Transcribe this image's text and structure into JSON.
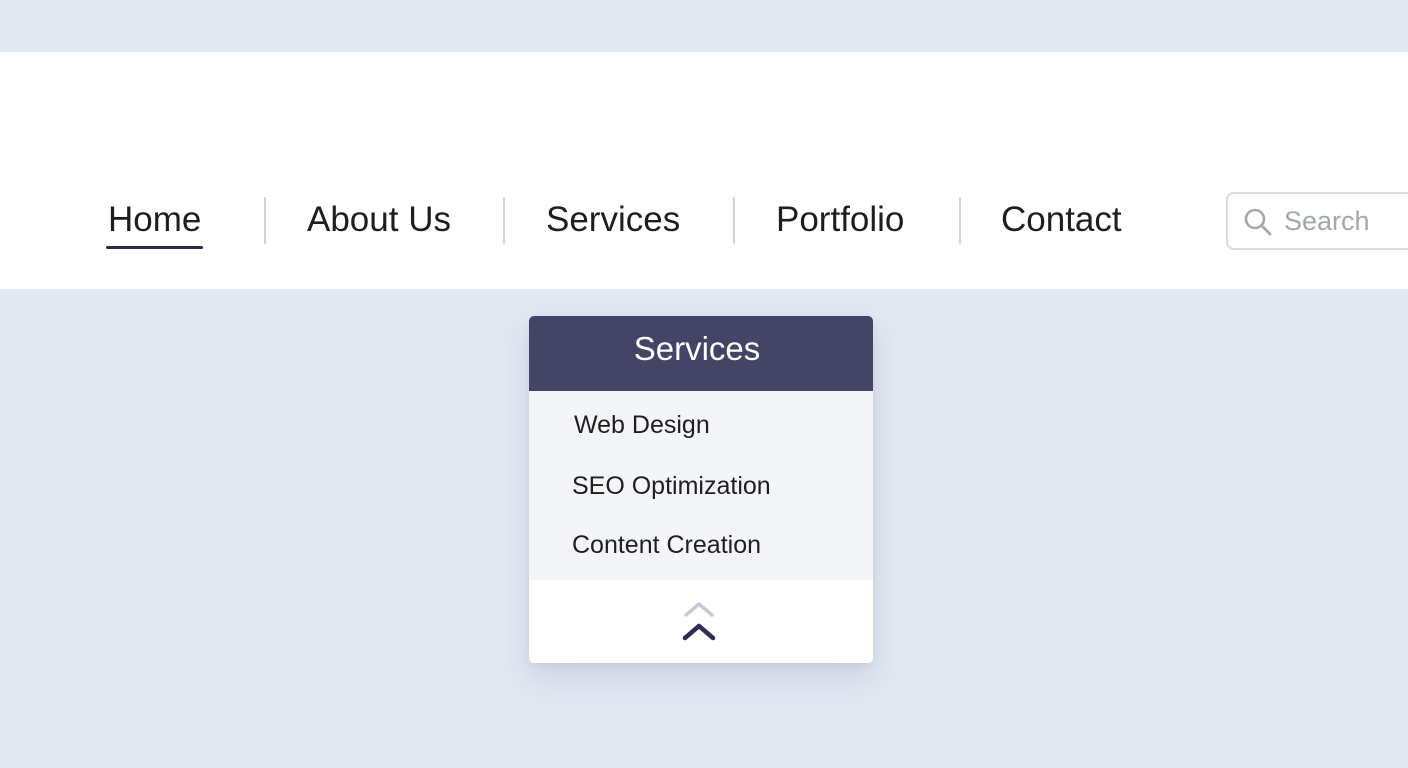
{
  "nav": {
    "items": [
      {
        "label": "Home",
        "active": true
      },
      {
        "label": "About Us",
        "active": false
      },
      {
        "label": "Services",
        "active": false
      },
      {
        "label": "Portfolio",
        "active": false
      },
      {
        "label": "Contact",
        "active": false
      }
    ]
  },
  "search": {
    "placeholder": "Search",
    "value": "",
    "icon": "search-icon"
  },
  "dropdown": {
    "title": "Services",
    "items": [
      {
        "label": "Web Design"
      },
      {
        "label": "SEO Optimization"
      },
      {
        "label": "Content Creation"
      }
    ],
    "collapse_icon": "double-chevron-up-icon"
  },
  "colors": {
    "page_background": "#e2e7f2",
    "navbar_background": "#ffffff",
    "dropdown_header": "#434466",
    "dropdown_list_background": "#f3f5f9",
    "active_underline": "#2a2a46",
    "text": "#1d1d22"
  }
}
